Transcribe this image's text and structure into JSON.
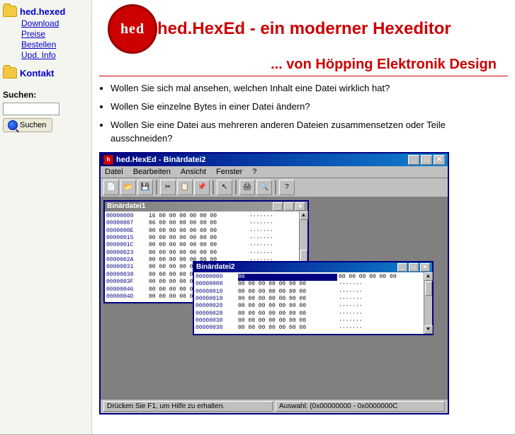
{
  "app": {
    "title": "hed.HexEd - ein moderner Hexeditor",
    "subtitle": "... von Höpping Elektronik Design",
    "logo_text": "hed"
  },
  "sidebar": {
    "nav_groups": [
      {
        "label": "hed.hexed",
        "sub_links": [
          "Download",
          "Preise",
          "Bestellen",
          "Upd. Info"
        ]
      },
      {
        "label": "Kontakt",
        "sub_links": []
      }
    ],
    "search": {
      "label": "Suchen:",
      "placeholder": "",
      "button_label": "Suchen"
    }
  },
  "content": {
    "bullets": [
      "Wollen Sie sich mal ansehen, welchen Inhalt eine Datei wirklich hat?",
      "Wollen Sie einzelne Bytes in einer Datei ändern?",
      "Wollen Sie eine Datei aus mehreren anderen Dateien zusammensetzen oder Teile ausschneiden?"
    ]
  },
  "hexeditor": {
    "main_window_title": "hed.HexEd - Binärdatei2",
    "menu_items": [
      "Datei",
      "Bearbeiten",
      "Ansicht",
      "Fenster",
      "?"
    ],
    "child1": {
      "title": "Binärdatei1",
      "rows": [
        {
          "addr": "00000000",
          "bytes": "16 00 00 00 00 00 00",
          "ascii": "· · · · · · ·"
        },
        {
          "addr": "00000007",
          "bytes": "06 00 00 00 00 00 00",
          "ascii": "· · · · · · ·"
        },
        {
          "addr": "0000000E",
          "bytes": "00 00 00 00 00 00 00",
          "ascii": "· · · · · · ·"
        },
        {
          "addr": "00000015",
          "bytes": "00 00 00 00 00 00 00",
          "ascii": "· · · · · · ·"
        },
        {
          "addr": "0000001C",
          "bytes": "00 00 00 00 00 00 00",
          "ascii": "· · · · · · ·"
        },
        {
          "addr": "00000023",
          "bytes": "00 00 00 00 00 00 00",
          "ascii": "· · · · · · ·"
        },
        {
          "addr": "0000002A",
          "bytes": "00 00 00 00 00 00 00",
          "ascii": "· · · · · · ·"
        },
        {
          "addr": "00000031",
          "bytes": "00 00 00 00 00 00 00",
          "ascii": "· · · · · · ·"
        },
        {
          "addr": "00000038",
          "bytes": "00 00 00 00 00 00 00",
          "ascii": "· · · · · · ·"
        },
        {
          "addr": "0000003F",
          "bytes": "00 00 00 00 00 00 00",
          "ascii": "· · · · · · ·"
        },
        {
          "addr": "00000046",
          "bytes": "00 00 00 00 00 00 00",
          "ascii": "· · · · · · ·"
        },
        {
          "addr": "0000004D",
          "bytes": "00 00 00 00 00 00 00",
          "ascii": "· · · · · · ·"
        }
      ]
    },
    "child2": {
      "title": "Binärdatei2",
      "rows": [
        {
          "addr": "00000000",
          "bytes": "06 00 00 00 00 00 00",
          "ascii": "· · · · · · ·",
          "highlight": true
        },
        {
          "addr": "00000008",
          "bytes": "00 00 00 00 00 00 00",
          "ascii": "· · · · · · ·"
        },
        {
          "addr": "00000010",
          "bytes": "00 00 00 00 00 00 00",
          "ascii": "· · · · · · ·"
        },
        {
          "addr": "00000018",
          "bytes": "00 00 00 00 00 00 00",
          "ascii": "· · · · · · ·"
        },
        {
          "addr": "00000020",
          "bytes": "00 00 00 00 00 00 00",
          "ascii": "· · · · · · ·"
        },
        {
          "addr": "00000028",
          "bytes": "00 00 00 00 00 00 00",
          "ascii": "· · · · · · ·"
        },
        {
          "addr": "00000030",
          "bytes": "00 00 00 00 00 00 00",
          "ascii": "· · · · · · ·"
        },
        {
          "addr": "00000038",
          "bytes": "00 00 00 00 00 00 00",
          "ascii": "· · · · · · ·"
        }
      ]
    },
    "statusbar_left": "Drücken Sie F1, um Hilfe zu erhalten.",
    "statusbar_right": "Auswahl: (0x00000000 - 0x0000000C"
  }
}
